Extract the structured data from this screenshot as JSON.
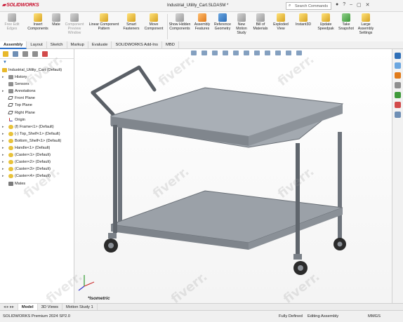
{
  "app": {
    "logo": "SOLIDWORKS",
    "title": "Industrial_Utility_Cart.SLDASM *",
    "search_placeholder": "Search Commands"
  },
  "ribbon": {
    "buttons": [
      {
        "label": "Insert Components",
        "enabled": true,
        "icon": "insert-components-icon"
      },
      {
        "label": "Mate",
        "enabled": true,
        "icon": "mate-icon"
      },
      {
        "label": "Component Preview Window",
        "enabled": false,
        "icon": "preview-window-icon"
      },
      {
        "label": "Linear Component Pattern",
        "enabled": true,
        "icon": "linear-pattern-icon"
      },
      {
        "label": "Smart Fasteners",
        "enabled": true,
        "icon": "smart-fasteners-icon"
      },
      {
        "label": "Move Component",
        "enabled": true,
        "icon": "move-component-icon"
      },
      {
        "label": "Show Hidden Components",
        "enabled": true,
        "icon": "show-hidden-icon"
      },
      {
        "label": "Assembly Features",
        "enabled": true,
        "icon": "assembly-features-icon"
      },
      {
        "label": "Reference Geometry",
        "enabled": true,
        "icon": "reference-geometry-icon"
      },
      {
        "label": "New Motion Study",
        "enabled": true,
        "icon": "motion-study-icon"
      },
      {
        "label": "Bill of Materials",
        "enabled": true,
        "icon": "bom-icon"
      },
      {
        "label": "Exploded View",
        "enabled": true,
        "icon": "exploded-view-icon"
      },
      {
        "label": "Instant3D",
        "enabled": true,
        "icon": "instant3d-icon"
      },
      {
        "label": "Update Speedpak",
        "enabled": true,
        "icon": "speedpak-icon"
      },
      {
        "label": "Take Snapshot",
        "enabled": true,
        "icon": "snapshot-icon"
      },
      {
        "label": "Large Assembly Settings",
        "enabled": true,
        "icon": "large-assembly-icon"
      }
    ],
    "first_button_label": "Free Edit Edges"
  },
  "tabs": [
    "Assembly",
    "Layout",
    "Sketch",
    "Markup",
    "Evaluate",
    "SOLIDWORKS Add-Ins",
    "MBD"
  ],
  "active_tab": "Assembly",
  "tree": {
    "root": "Industrial_Utility_Cart  (Default)",
    "items": [
      {
        "label": "History",
        "arrow": true,
        "icon": "note"
      },
      {
        "label": "Sensors",
        "arrow": false,
        "icon": "note"
      },
      {
        "label": "Annotations",
        "arrow": true,
        "icon": "note"
      },
      {
        "label": "Front Plane",
        "arrow": false,
        "icon": "plane"
      },
      {
        "label": "Top Plane",
        "arrow": false,
        "icon": "plane"
      },
      {
        "label": "Right Plane",
        "arrow": false,
        "icon": "plane"
      },
      {
        "label": "Origin",
        "arrow": false,
        "icon": "origin"
      },
      {
        "label": "(f) Frame<1> (Default)",
        "arrow": true,
        "icon": "part"
      },
      {
        "label": "(-) Top_Shelf<1> (Default)",
        "arrow": true,
        "icon": "part"
      },
      {
        "label": "Bottom_Shelf<1> (Default)",
        "arrow": true,
        "icon": "part"
      },
      {
        "label": "Handle<1> (Default)",
        "arrow": true,
        "icon": "part"
      },
      {
        "label": "(Caster<1> (Default)",
        "arrow": true,
        "icon": "part"
      },
      {
        "label": "(Caster<2> (Default)",
        "arrow": true,
        "icon": "part"
      },
      {
        "label": "(Caster<3> (Default)",
        "arrow": true,
        "icon": "part"
      },
      {
        "label": "(Caster<4> (Default)",
        "arrow": true,
        "icon": "part"
      },
      {
        "label": "Mates",
        "arrow": false,
        "icon": "mate"
      }
    ]
  },
  "viewport": {
    "view_label": "*Isometric"
  },
  "bottom_tabs": [
    "Model",
    "3D Views",
    "Motion Study 1"
  ],
  "active_bottom_tab": "Model",
  "status": {
    "version": "SOLIDWORKS Premium 2024 SP2.0",
    "state": "Fully Defined",
    "mode": "Editing Assembly",
    "units": "MMGS"
  },
  "watermark": "fiverr.",
  "colors": {
    "brand": "#c8102e",
    "accent": "#2a6fc9",
    "cart_metal": "#8c9198"
  }
}
